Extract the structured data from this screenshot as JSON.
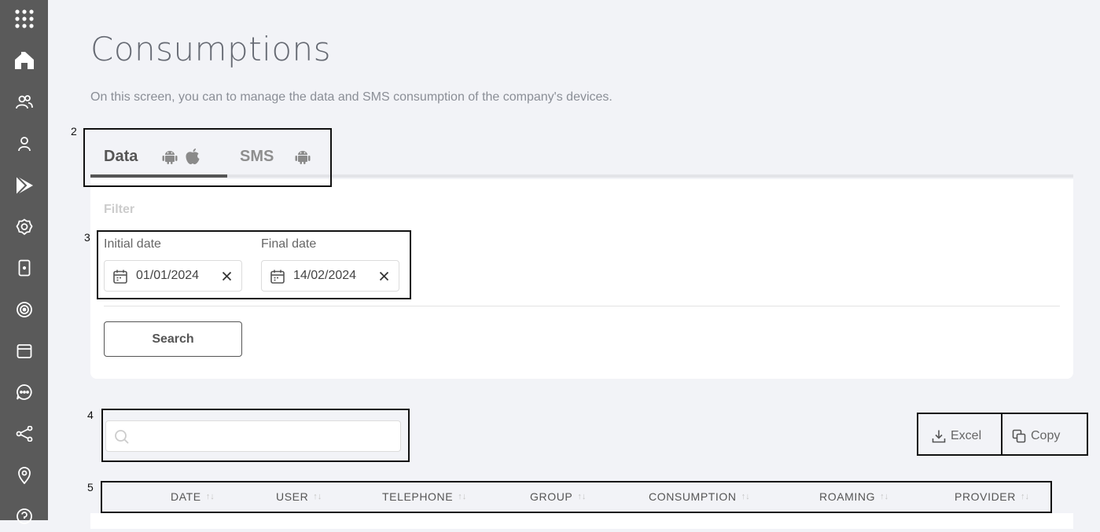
{
  "sidebar": {
    "icons": [
      "apps-grid-icon",
      "dashboard-icon",
      "users-icon",
      "user-icon",
      "play-store-icon",
      "settings-icon",
      "device-icon",
      "radar-icon",
      "window-icon",
      "chat-icon",
      "share-icon",
      "location-icon",
      "help-icon"
    ]
  },
  "page": {
    "title": "Consumptions",
    "subtitle": "On this screen, you can to manage the data and SMS consumption of the company's devices."
  },
  "markers": {
    "m2": "2",
    "m3": "3",
    "m4": "4",
    "m5": "5"
  },
  "tabs": [
    {
      "label": "Data",
      "icons": [
        "android-icon",
        "apple-icon"
      ],
      "active": true
    },
    {
      "label": "SMS",
      "icons": [
        "android-icon"
      ],
      "active": false
    }
  ],
  "filter": {
    "title": "Filter",
    "initial_label": "Initial date",
    "initial_value": "01/01/2024",
    "final_label": "Final date",
    "final_value": "14/02/2024",
    "search_label": "Search"
  },
  "table": {
    "search_placeholder": "",
    "excel_label": "Excel",
    "copy_label": "Copy",
    "columns": [
      "DATE",
      "USER",
      "TELEPHONE",
      "GROUP",
      "CONSUMPTION",
      "ROAMING",
      "PROVIDER"
    ],
    "sort_glyph": "↑↓"
  },
  "colors": {
    "sidebar": "#5a5a5a",
    "background": "#f2f3f7",
    "accent": "#555555"
  }
}
